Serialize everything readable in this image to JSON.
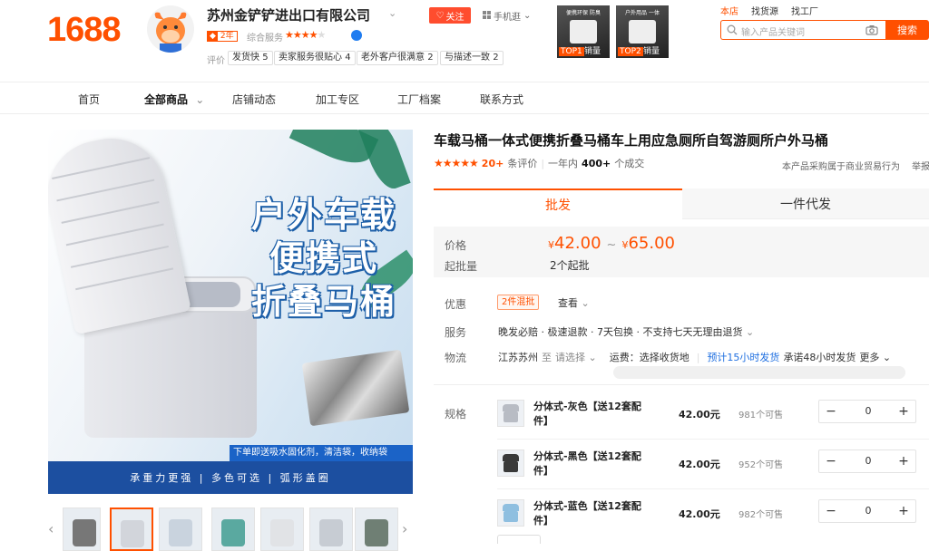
{
  "header": {
    "logo": "1688",
    "shop_name": "苏州金铲铲进出口有限公司",
    "follow_label": "关注",
    "mobile_label": "手机逛",
    "year_badge": "2年",
    "service_label": "综合服务",
    "service_stars": 4,
    "eval_label": "评价",
    "eval_tags": [
      {
        "label": "发货快",
        "score": "5"
      },
      {
        "label": "卖家服务很贴心",
        "score": "4"
      },
      {
        "label": "老外客户很满意",
        "score": "2"
      },
      {
        "label": "与描述一致",
        "score": "2"
      }
    ],
    "top_items": [
      {
        "rank": "TOP1",
        "sold": "销量",
        "caption": "便携环保 防臭"
      },
      {
        "rank": "TOP2",
        "sold": "销量",
        "caption": "户外用品 一体"
      }
    ]
  },
  "search": {
    "tabs": [
      "本店",
      "找货源",
      "找工厂"
    ],
    "active_tab": "本店",
    "placeholder": "输入产品关键词",
    "button_label": "搜索"
  },
  "nav": {
    "items": [
      "首页",
      "全部商品",
      "店铺动态",
      "加工专区",
      "工厂档案",
      "联系方式"
    ]
  },
  "gallery": {
    "headline_lines": [
      "户外车载",
      "便携式",
      "折叠马桶"
    ],
    "promo_line": "下单即送吸水固化剂，清洁袋，收纳袋",
    "feature_bar": "承重力更强 | 多色可选 | 弧形盖圈"
  },
  "product": {
    "title": "车载马桶一体式便携折叠马桶车上用应急厕所自驾游厕所户外马桶",
    "stars": "★★★★★",
    "reviews_count": "20+",
    "reviews_label": "条评价",
    "year_label": "一年内",
    "deals_count": "400+",
    "deals_label": "个成交",
    "behavior_note": "本产品采购属于商业贸易行为",
    "report_label": "举报",
    "tabs": {
      "wholesale": "批发",
      "dropship": "一件代发"
    },
    "price_label": "价格",
    "price_min": "42.00",
    "price_max": "65.00",
    "currency": "¥",
    "moq_label": "起批量",
    "moq_value": "2个起批",
    "promo_label": "优惠",
    "promo_badge": "2件混批",
    "promo_check": "查看",
    "service_label": "服务",
    "service_text": "晚发必赔 · 极速退款 · 7天包换 · 不支持七天无理由退货",
    "logistics_label": "物流",
    "logistics_from": "江苏苏州",
    "logistics_to_word": "至",
    "logistics_select": "请选择",
    "shipping_fee": "运费：选择收货地",
    "ship_time": "预计15小时发货",
    "promise": "承诺48小时发货",
    "more": "更多",
    "spec_label": "规格",
    "skus": [
      {
        "name": "分体式-灰色【送12套配件】",
        "price": "42.00元",
        "stock": "981个可售",
        "qty": "0",
        "color": "#b8bcc4"
      },
      {
        "name": "分体式-黑色【送12套配件】",
        "price": "42.00元",
        "stock": "952个可售",
        "qty": "0",
        "color": "#3a3a3a"
      },
      {
        "name": "分体式-蓝色【送12套配件】",
        "price": "42.00元",
        "stock": "982个可售",
        "qty": "0",
        "color": "#8fbfe0"
      }
    ]
  },
  "colors": {
    "brand": "#ff5000",
    "blue_link": "#1f6fe0",
    "banner_blue": "#1c4fa0"
  }
}
